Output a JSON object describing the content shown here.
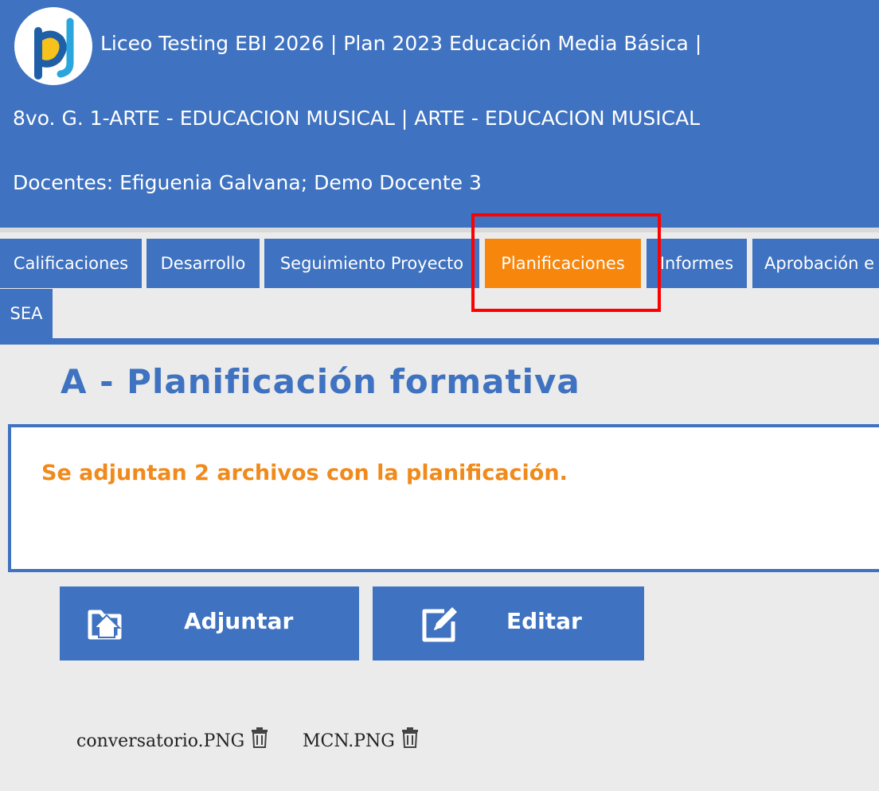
{
  "header": {
    "line1": "Liceo Testing EBI 2026 | Plan 2023 Educación Media Básica |",
    "line2": "8vo. G. 1-ARTE - EDUCACION MUSICAL | ARTE - EDUCACION MUSICAL",
    "line3": "Docentes: Efiguenia Galvana; Demo Docente 3",
    "logo_icon": "pd-logo"
  },
  "tabs": [
    {
      "label": "Calificaciones"
    },
    {
      "label": "Desarrollo"
    },
    {
      "label": "Seguimiento Proyecto"
    },
    {
      "label": "Planificaciones",
      "active": true
    },
    {
      "label": "Informes"
    },
    {
      "label": "Aprobación e"
    },
    {
      "label": "SEA"
    }
  ],
  "section": {
    "title": "A - Planificación formativa",
    "body": "Se adjuntan 2 archivos con la planificación."
  },
  "buttons": {
    "adjuntar": {
      "label": "Adjuntar",
      "icon": "upload-folder-icon"
    },
    "editar": {
      "label": "Editar",
      "icon": "edit-icon"
    }
  },
  "files": [
    {
      "name": "conversatorio.PNG",
      "icon": "trash-icon"
    },
    {
      "name": "MCN.PNG",
      "icon": "trash-icon"
    }
  ],
  "colors": {
    "primary": "#3f72c0",
    "accent": "#f7860c",
    "highlight": "#ff0000",
    "background": "#ebebeb"
  }
}
